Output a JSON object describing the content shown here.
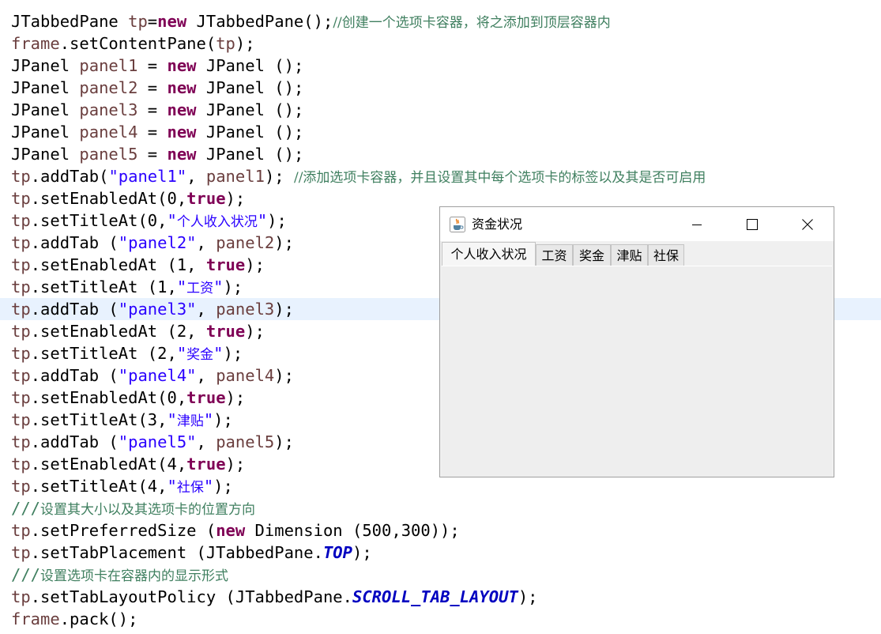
{
  "code": {
    "l1": {
      "a": "JTabbedPane ",
      "b": "tp",
      "c": "=",
      "d": "new",
      "e": " JTabbedPane();",
      "f": "//创建一个选项卡容器，将之添加到顶层容器内"
    },
    "l2": {
      "a": "frame",
      "b": ".setContentPane(",
      "c": "tp",
      "d": ");"
    },
    "panels": [
      {
        "a": "JPanel ",
        "b": "panel1",
        "c": " = ",
        "d": "new",
        "e": " JPanel ();"
      },
      {
        "a": "JPanel ",
        "b": "panel2",
        "c": " = ",
        "d": "new",
        "e": " JPanel ();"
      },
      {
        "a": "JPanel ",
        "b": "panel3",
        "c": " = ",
        "d": "new",
        "e": " JPanel ();"
      },
      {
        "a": "JPanel ",
        "b": "panel4",
        "c": " = ",
        "d": "new",
        "e": " JPanel ();"
      },
      {
        "a": "JPanel ",
        "b": "panel5",
        "c": " = ",
        "d": "new",
        "e": " JPanel ();"
      }
    ],
    "l8": {
      "a": "tp",
      "b": ".addTab(",
      "c": "\"panel1\"",
      "d": ", ",
      "e": "panel1",
      "f": "); ",
      "g": "//添加选项卡容器，并且设置其中每个选项卡的标签以及其是否可启用"
    },
    "l9": {
      "a": "tp",
      "b": ".setEnabledAt(0,",
      "c": "true",
      "d": ");"
    },
    "l10": {
      "a": "tp",
      "b": ".setTitleAt(0,",
      "c": "\"",
      "d": "个人收入状况",
      "e": "\"",
      "f": ");"
    },
    "l11": {
      "a": "tp",
      "b": ".addTab (",
      "c": "\"panel2\"",
      "d": ", ",
      "e": "panel2",
      "f": ");"
    },
    "l12": {
      "a": "tp",
      "b": ".setEnabledAt (1, ",
      "c": "true",
      "d": ");"
    },
    "l13": {
      "a": "tp",
      "b": ".setTitleAt (1,",
      "c": "\"",
      "d": "工资",
      "e": "\"",
      "f": ");"
    },
    "l14": {
      "a": "tp",
      "b": ".addTab (",
      "c": "\"panel3\"",
      "d": ", ",
      "e": "panel3",
      "f": ");"
    },
    "l15": {
      "a": "tp",
      "b": ".setEnabledAt (2, ",
      "c": "true",
      "d": ");"
    },
    "l16": {
      "a": "tp",
      "b": ".setTitleAt (2,",
      "c": "\"",
      "d": "奖金",
      "e": "\"",
      "f": ");"
    },
    "l17": {
      "a": "tp",
      "b": ".addTab (",
      "c": "\"panel4\"",
      "d": ", ",
      "e": "panel4",
      "f": ");"
    },
    "l18": {
      "a": "tp",
      "b": ".setEnabledAt(0,",
      "c": "true",
      "d": ");"
    },
    "l19": {
      "a": "tp",
      "b": ".setTitleAt(3,",
      "c": "\"",
      "d": "津贴",
      "e": "\"",
      "f": ");"
    },
    "l20": {
      "a": "tp",
      "b": ".addTab (",
      "c": "\"panel5\"",
      "d": ", ",
      "e": "panel5",
      "f": ");"
    },
    "l21": {
      "a": "tp",
      "b": ".setEnabledAt(4,",
      "c": "true",
      "d": ");"
    },
    "l22": {
      "a": "tp",
      "b": ".setTitleAt(4,",
      "c": "\"",
      "d": "社保",
      "e": "\"",
      "f": ");"
    },
    "l23": {
      "a": "///",
      "b": "设置其大小以及其选项卡的位置方向"
    },
    "l24": {
      "a": "tp",
      "b": ".setPreferredSize (",
      "c": "new",
      "d": " Dimension (500,300));"
    },
    "l25": {
      "a": "tp",
      "b": ".setTabPlacement (JTabbedPane.",
      "c": "TOP",
      "d": ");"
    },
    "l26": {
      "a": "///",
      "b": "设置选项卡在容器内的显示形式"
    },
    "l27": {
      "a": "tp",
      "b": ".setTabLayoutPolicy (JTabbedPane.",
      "c": "SCROLL_TAB_LAYOUT",
      "d": ");"
    },
    "l28": {
      "a": "frame",
      "b": ".pack();"
    }
  },
  "window": {
    "title": "资金状况",
    "icon": "java-icon",
    "buttons": [
      "minimize-icon",
      "maximize-icon",
      "close-icon"
    ],
    "tabs": [
      "个人收入状况",
      "工资",
      "奖金",
      "津贴",
      "社保"
    ],
    "selected_tab": "个人收入状况"
  },
  "colors": {
    "keyword": "#7f0055",
    "string": "#2a00ff",
    "variable": "#6a3e3e",
    "comment": "#3f7f5f",
    "constant": "#0000c0",
    "current_line": "#e8f2fe"
  }
}
